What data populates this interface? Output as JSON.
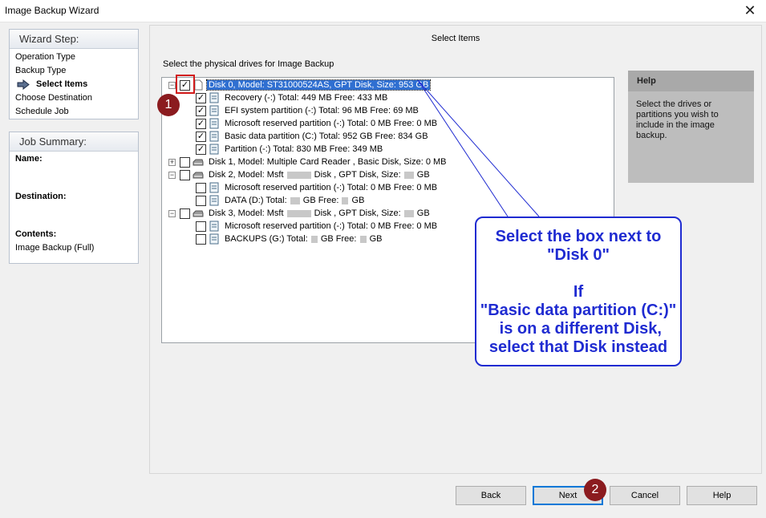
{
  "window": {
    "title": "Image Backup Wizard",
    "close_glyph": "✕"
  },
  "wizard": {
    "header": "Wizard Step:",
    "steps": [
      "Operation Type",
      "Backup Type",
      "Select Items",
      "Choose Destination",
      "Schedule Job"
    ],
    "current_index": 2
  },
  "job_summary": {
    "header": "Job Summary:",
    "name_label": "Name:",
    "destination_label": "Destination:",
    "contents_label": "Contents:",
    "contents_value": "Image Backup (Full)"
  },
  "content": {
    "title": "Select Items",
    "instruction": "Select the physical drives for Image Backup"
  },
  "tree": {
    "disk0": {
      "label": "Disk 0, Model: ST31000524AS, GPT Disk, Size: 953 GB",
      "checked": true,
      "expanded": true
    },
    "disk0_parts": [
      "Recovery (-:) Total: 449 MB  Free: 433 MB",
      "EFI system partition (-:) Total: 96 MB  Free: 69 MB",
      "Microsoft reserved partition (-:) Total: 0 MB  Free: 0 MB",
      "Basic data partition (C:) Total: 952 GB  Free: 834 GB",
      "Partition (-:) Total: 830 MB  Free: 349 MB"
    ],
    "disk1": {
      "label": "Disk 1, Model: Multiple Card  Reader    , Basic Disk, Size: 0 MB",
      "checked": false,
      "expanded": false
    },
    "disk2": {
      "label_a": "Disk 2, Model: Msft",
      "label_b": "Disk",
      "label_c": ", GPT Disk, Size:",
      "label_d": "GB",
      "checked": false,
      "expanded": true
    },
    "disk2_parts": {
      "p1": "Microsoft reserved partition (-:) Total: 0 MB  Free: 0 MB",
      "p2_a": "DATA (D:) Total:",
      "p2_b": "GB  Free:",
      "p2_c": "GB"
    },
    "disk3": {
      "label_a": "Disk 3, Model: Msft",
      "label_b": "Disk",
      "label_c": ", GPT Disk, Size:",
      "label_d": "GB",
      "checked": false,
      "expanded": true
    },
    "disk3_parts": {
      "p1": "Microsoft reserved partition (-:) Total: 0 MB  Free: 0 MB",
      "p2_a": "BACKUPS (G:) Total:",
      "p2_b": "GB  Free:",
      "p2_c": "GB"
    }
  },
  "help": {
    "title": "Help",
    "text": "Select the drives or partitions you wish to include in the image backup."
  },
  "callout": {
    "lines": [
      "Select the box next to",
      "\"Disk 0\"",
      "",
      "If",
      "\"Basic data partition (C:)\"",
      " is on a different Disk,",
      "select that Disk instead"
    ]
  },
  "badges": {
    "first": "1",
    "second": "2"
  },
  "buttons": {
    "back": "Back",
    "next": "Next",
    "cancel": "Cancel",
    "help": "Help"
  },
  "colors": {
    "callout": "#1f2bd1",
    "badge": "#8b1b1f",
    "highlight": "#d11a1a",
    "selection": "#2f6fd1"
  }
}
